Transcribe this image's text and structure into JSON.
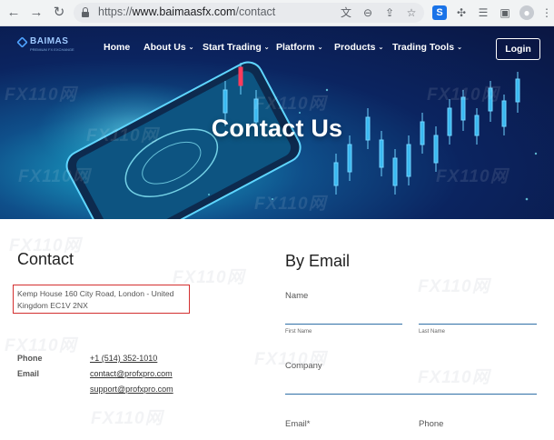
{
  "browser": {
    "url_scheme": "https://",
    "url_host": "www.baimaasfx.com",
    "url_path": "/contact",
    "back_icon": "back-arrow-icon",
    "forward_icon": "forward-arrow-icon",
    "reload_icon": "reload-icon"
  },
  "site": {
    "logo_text": "BAIMAS",
    "logo_subtext": "PREMIUM FX EXCHANGE",
    "nav": [
      {
        "label": "Home"
      },
      {
        "label": "About Us",
        "caret": "⌄"
      },
      {
        "label": "Start Trading",
        "caret": "⌄"
      },
      {
        "label": "Platform",
        "caret": "⌄"
      },
      {
        "label": "Products",
        "caret": "⌄"
      },
      {
        "label": "Trading Tools",
        "caret": "⌄"
      }
    ],
    "login_label": "Login",
    "hero_title": "Contact Us"
  },
  "contact": {
    "heading": "Contact",
    "address": "Kemp House 160 City Road, London - United Kingdom EC1V 2NX",
    "phone_label": "Phone",
    "phone_value": "+1 (514) 352-1010",
    "email_label": "Email",
    "emails": [
      "contact@profxpro.com",
      "support@profxpro.com"
    ]
  },
  "email_form": {
    "heading": "By Email",
    "name_label": "Name",
    "first_name_label": "First Name",
    "last_name_label": "Last Name",
    "company_label": "Company",
    "email_label": "Email*",
    "phone_label": "Phone"
  },
  "watermark": "FX110网",
  "colors": {
    "accent_line": "#2f6fa7",
    "highlight_box": "#d32f2f",
    "hero_bg": "#0b2460"
  }
}
